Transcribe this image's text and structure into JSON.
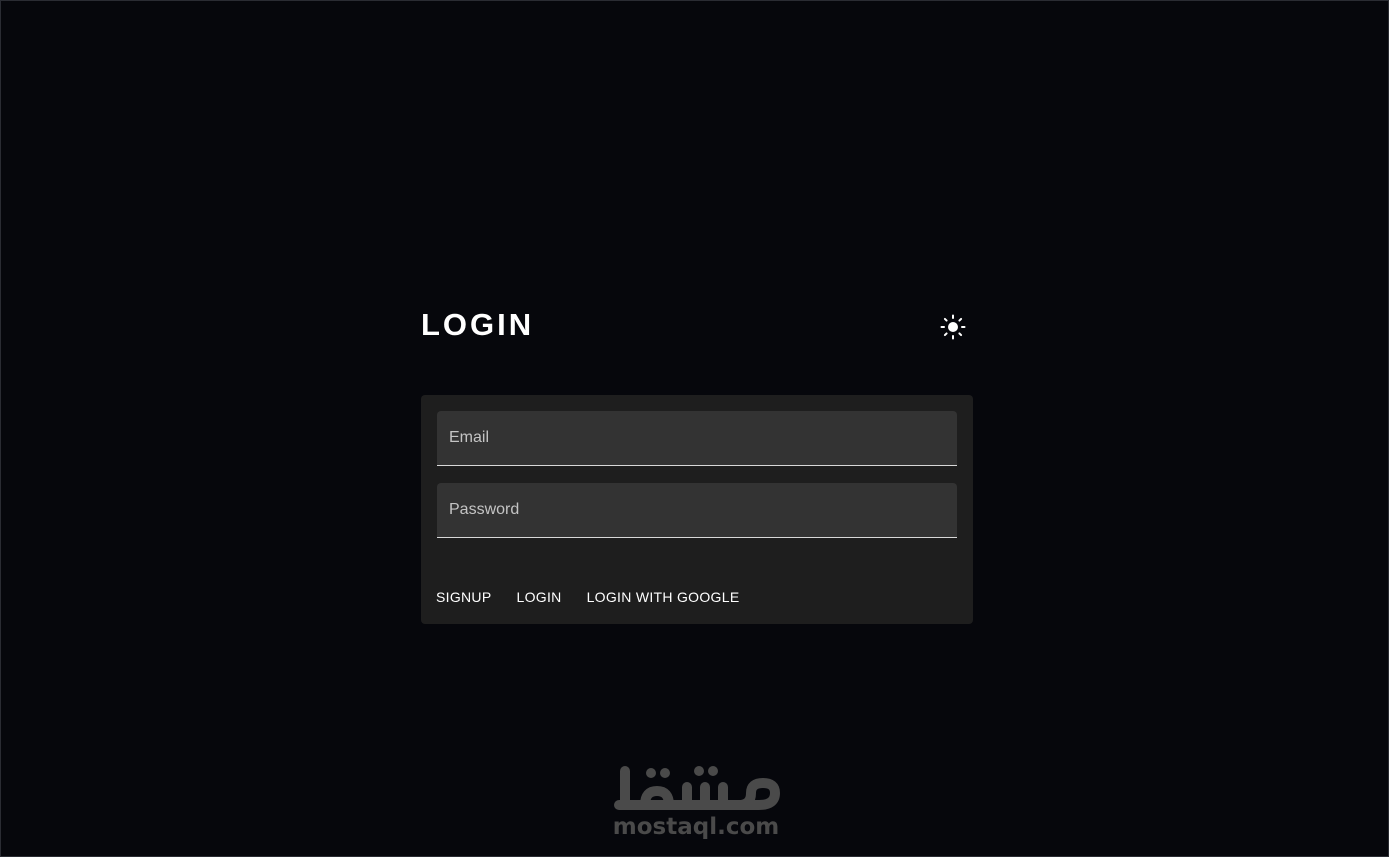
{
  "header": {
    "title": "LOGIN",
    "theme_icon": "sun-icon"
  },
  "form": {
    "email": {
      "placeholder": "Email",
      "value": ""
    },
    "password": {
      "placeholder": "Password",
      "value": ""
    }
  },
  "actions": {
    "signup_label": "SIGNUP",
    "login_label": "LOGIN",
    "google_label": "LOGIN WITH GOOGLE"
  },
  "watermark": {
    "text": "mostaql.com"
  },
  "colors": {
    "background": "#06070c",
    "card": "#1e1e1e",
    "field": "#333333",
    "text": "#ffffff",
    "watermark": "#4a4a4a"
  }
}
